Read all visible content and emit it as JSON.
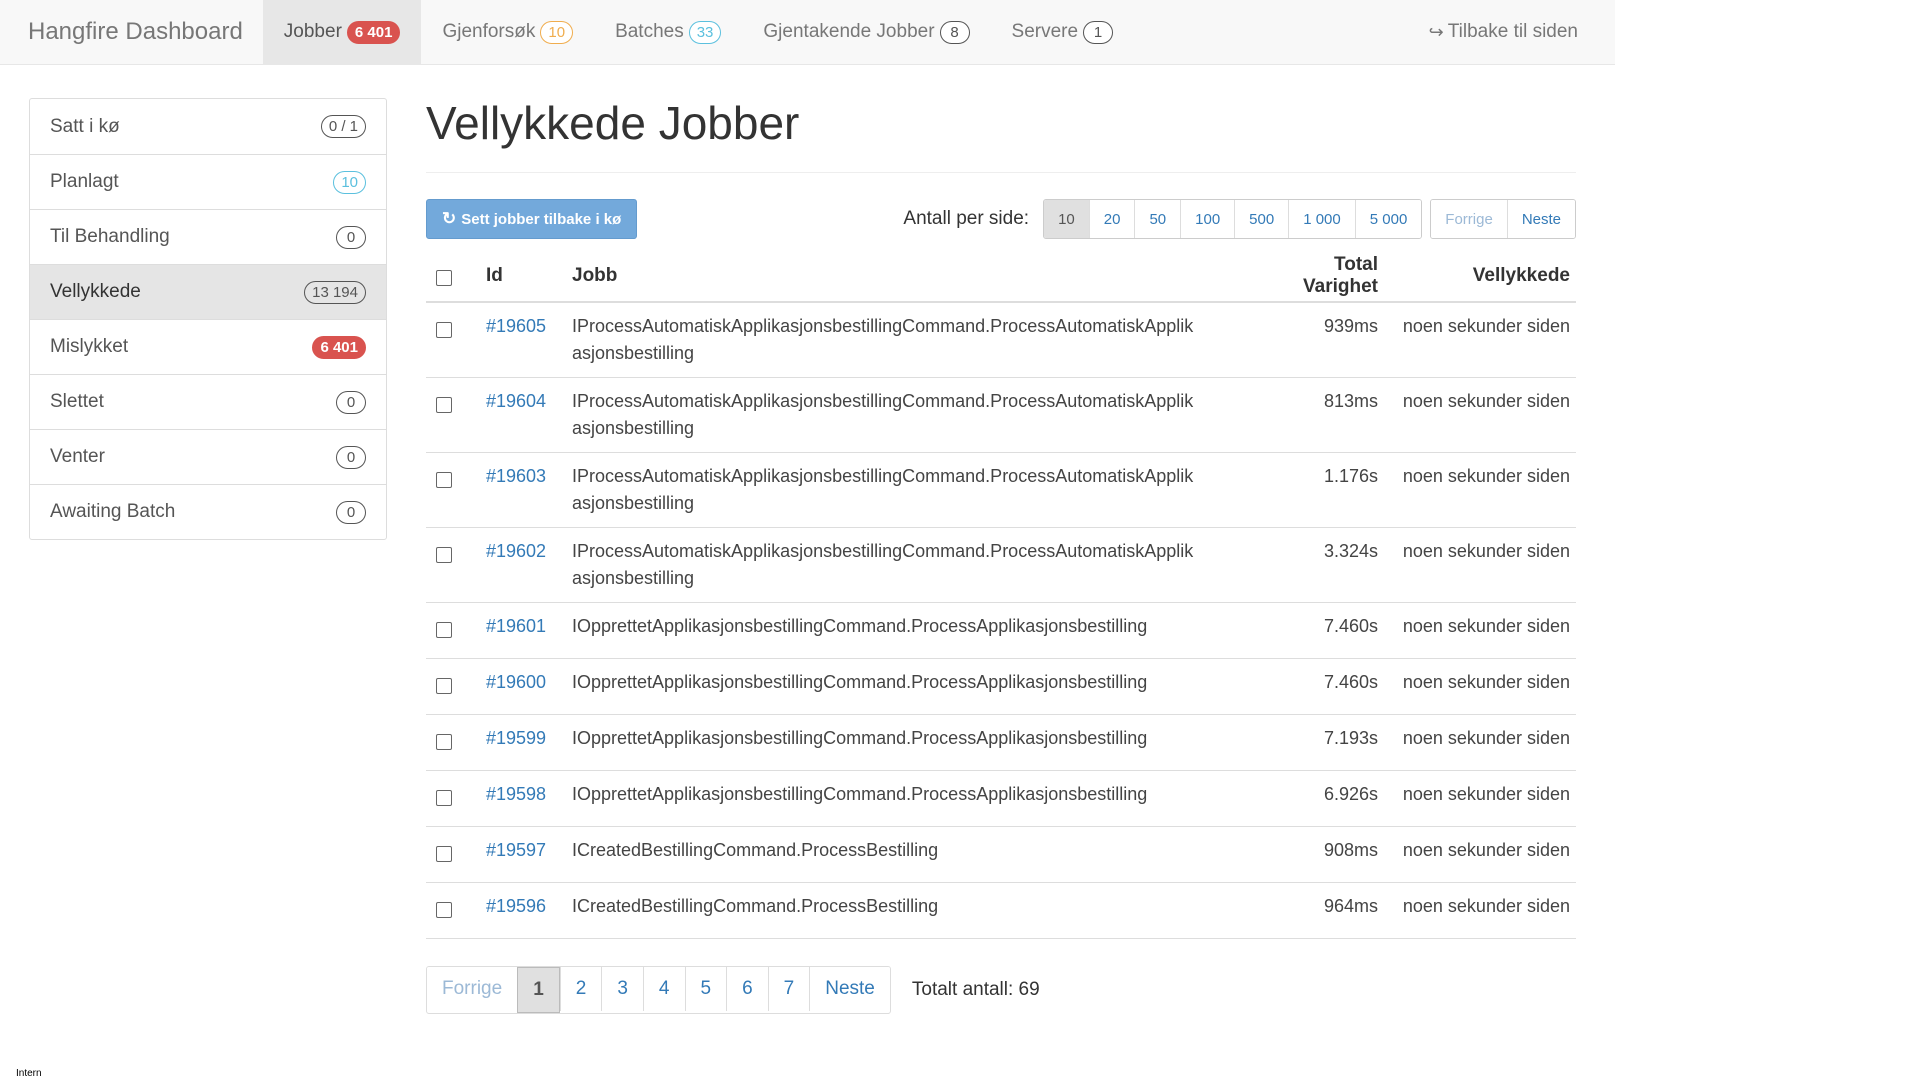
{
  "navbar": {
    "brand": "Hangfire Dashboard",
    "items": [
      {
        "label": "Jobber",
        "badge": "6 401",
        "badge_style": "danger",
        "active": true
      },
      {
        "label": "Gjenforsøk",
        "badge": "10",
        "badge_style": "warning"
      },
      {
        "label": "Batches",
        "badge": "33",
        "badge_style": "info"
      },
      {
        "label": "Gjentakende Jobber",
        "badge": "8",
        "badge_style": "default"
      },
      {
        "label": "Servere",
        "badge": "1",
        "badge_style": "default"
      }
    ],
    "back_label": "Tilbake til siden",
    "back_icon": "sign-out-icon"
  },
  "sidebar": {
    "items": [
      {
        "label": "Satt i kø",
        "badge": "0 / 1",
        "badge_style": "default"
      },
      {
        "label": "Planlagt",
        "badge": "10",
        "badge_style": "info"
      },
      {
        "label": "Til Behandling",
        "badge": "0",
        "badge_style": "default"
      },
      {
        "label": "Vellykkede",
        "badge": "13 194",
        "badge_style": "muted",
        "active": true
      },
      {
        "label": "Mislykket",
        "badge": "6 401",
        "badge_style": "danger"
      },
      {
        "label": "Slettet",
        "badge": "0",
        "badge_style": "default"
      },
      {
        "label": "Venter",
        "badge": "0",
        "badge_style": "default"
      },
      {
        "label": "Awaiting Batch",
        "badge": "0",
        "badge_style": "default"
      }
    ]
  },
  "main": {
    "title": "Vellykkede Jobber",
    "requeue_label": "Sett jobber tilbake i kø",
    "requeue_icon": "refresh-icon",
    "per_page_label": "Antall per side:",
    "per_page_options": [
      "10",
      "20",
      "50",
      "100",
      "500",
      "1 000",
      "5 000"
    ],
    "per_page_selected": "10",
    "pager_prev": "Forrige",
    "pager_next": "Neste",
    "table": {
      "headers": {
        "id": "Id",
        "job": "Jobb",
        "duration": "Total Varighet",
        "succeeded": "Vellykkede"
      },
      "rows": [
        {
          "id": "#19605",
          "job": [
            "IProcessAutomatiskApplikasjonsbestillingCommand.ProcessAutomatiskApplik",
            "asjonsbestilling"
          ],
          "duration": "939ms",
          "ago": "noen sekunder siden"
        },
        {
          "id": "#19604",
          "job": [
            "IProcessAutomatiskApplikasjonsbestillingCommand.ProcessAutomatiskApplik",
            "asjonsbestilling"
          ],
          "duration": "813ms",
          "ago": "noen sekunder siden"
        },
        {
          "id": "#19603",
          "job": [
            "IProcessAutomatiskApplikasjonsbestillingCommand.ProcessAutomatiskApplik",
            "asjonsbestilling"
          ],
          "duration": "1.176s",
          "ago": "noen sekunder siden"
        },
        {
          "id": "#19602",
          "job": [
            "IProcessAutomatiskApplikasjonsbestillingCommand.ProcessAutomatiskApplik",
            "asjonsbestilling"
          ],
          "duration": "3.324s",
          "ago": "noen sekunder siden"
        },
        {
          "id": "#19601",
          "job": [
            "IOpprettetApplikasjonsbestillingCommand.ProcessApplikasjonsbestilling"
          ],
          "duration": "7.460s",
          "ago": "noen sekunder siden"
        },
        {
          "id": "#19600",
          "job": [
            "IOpprettetApplikasjonsbestillingCommand.ProcessApplikasjonsbestilling"
          ],
          "duration": "7.460s",
          "ago": "noen sekunder siden"
        },
        {
          "id": "#19599",
          "job": [
            "IOpprettetApplikasjonsbestillingCommand.ProcessApplikasjonsbestilling"
          ],
          "duration": "7.193s",
          "ago": "noen sekunder siden"
        },
        {
          "id": "#19598",
          "job": [
            "IOpprettetApplikasjonsbestillingCommand.ProcessApplikasjonsbestilling"
          ],
          "duration": "6.926s",
          "ago": "noen sekunder siden"
        },
        {
          "id": "#19597",
          "job": [
            "ICreatedBestillingCommand.ProcessBestilling"
          ],
          "duration": "908ms",
          "ago": "noen sekunder siden"
        },
        {
          "id": "#19596",
          "job": [
            "ICreatedBestillingCommand.ProcessBestilling"
          ],
          "duration": "964ms",
          "ago": "noen sekunder siden"
        }
      ]
    },
    "pagination": {
      "prev": "Forrige",
      "pages": [
        "1",
        "2",
        "3",
        "4",
        "5",
        "6",
        "7"
      ],
      "current": "1",
      "next": "Neste",
      "total": "Totalt antall: 69"
    }
  },
  "footer_label": "Intern",
  "colors": {
    "danger": "#d9534f",
    "info": "#5bc0de",
    "warning": "#f0ad4e",
    "link": "#337ab7",
    "primary": "#5b9bd5"
  }
}
